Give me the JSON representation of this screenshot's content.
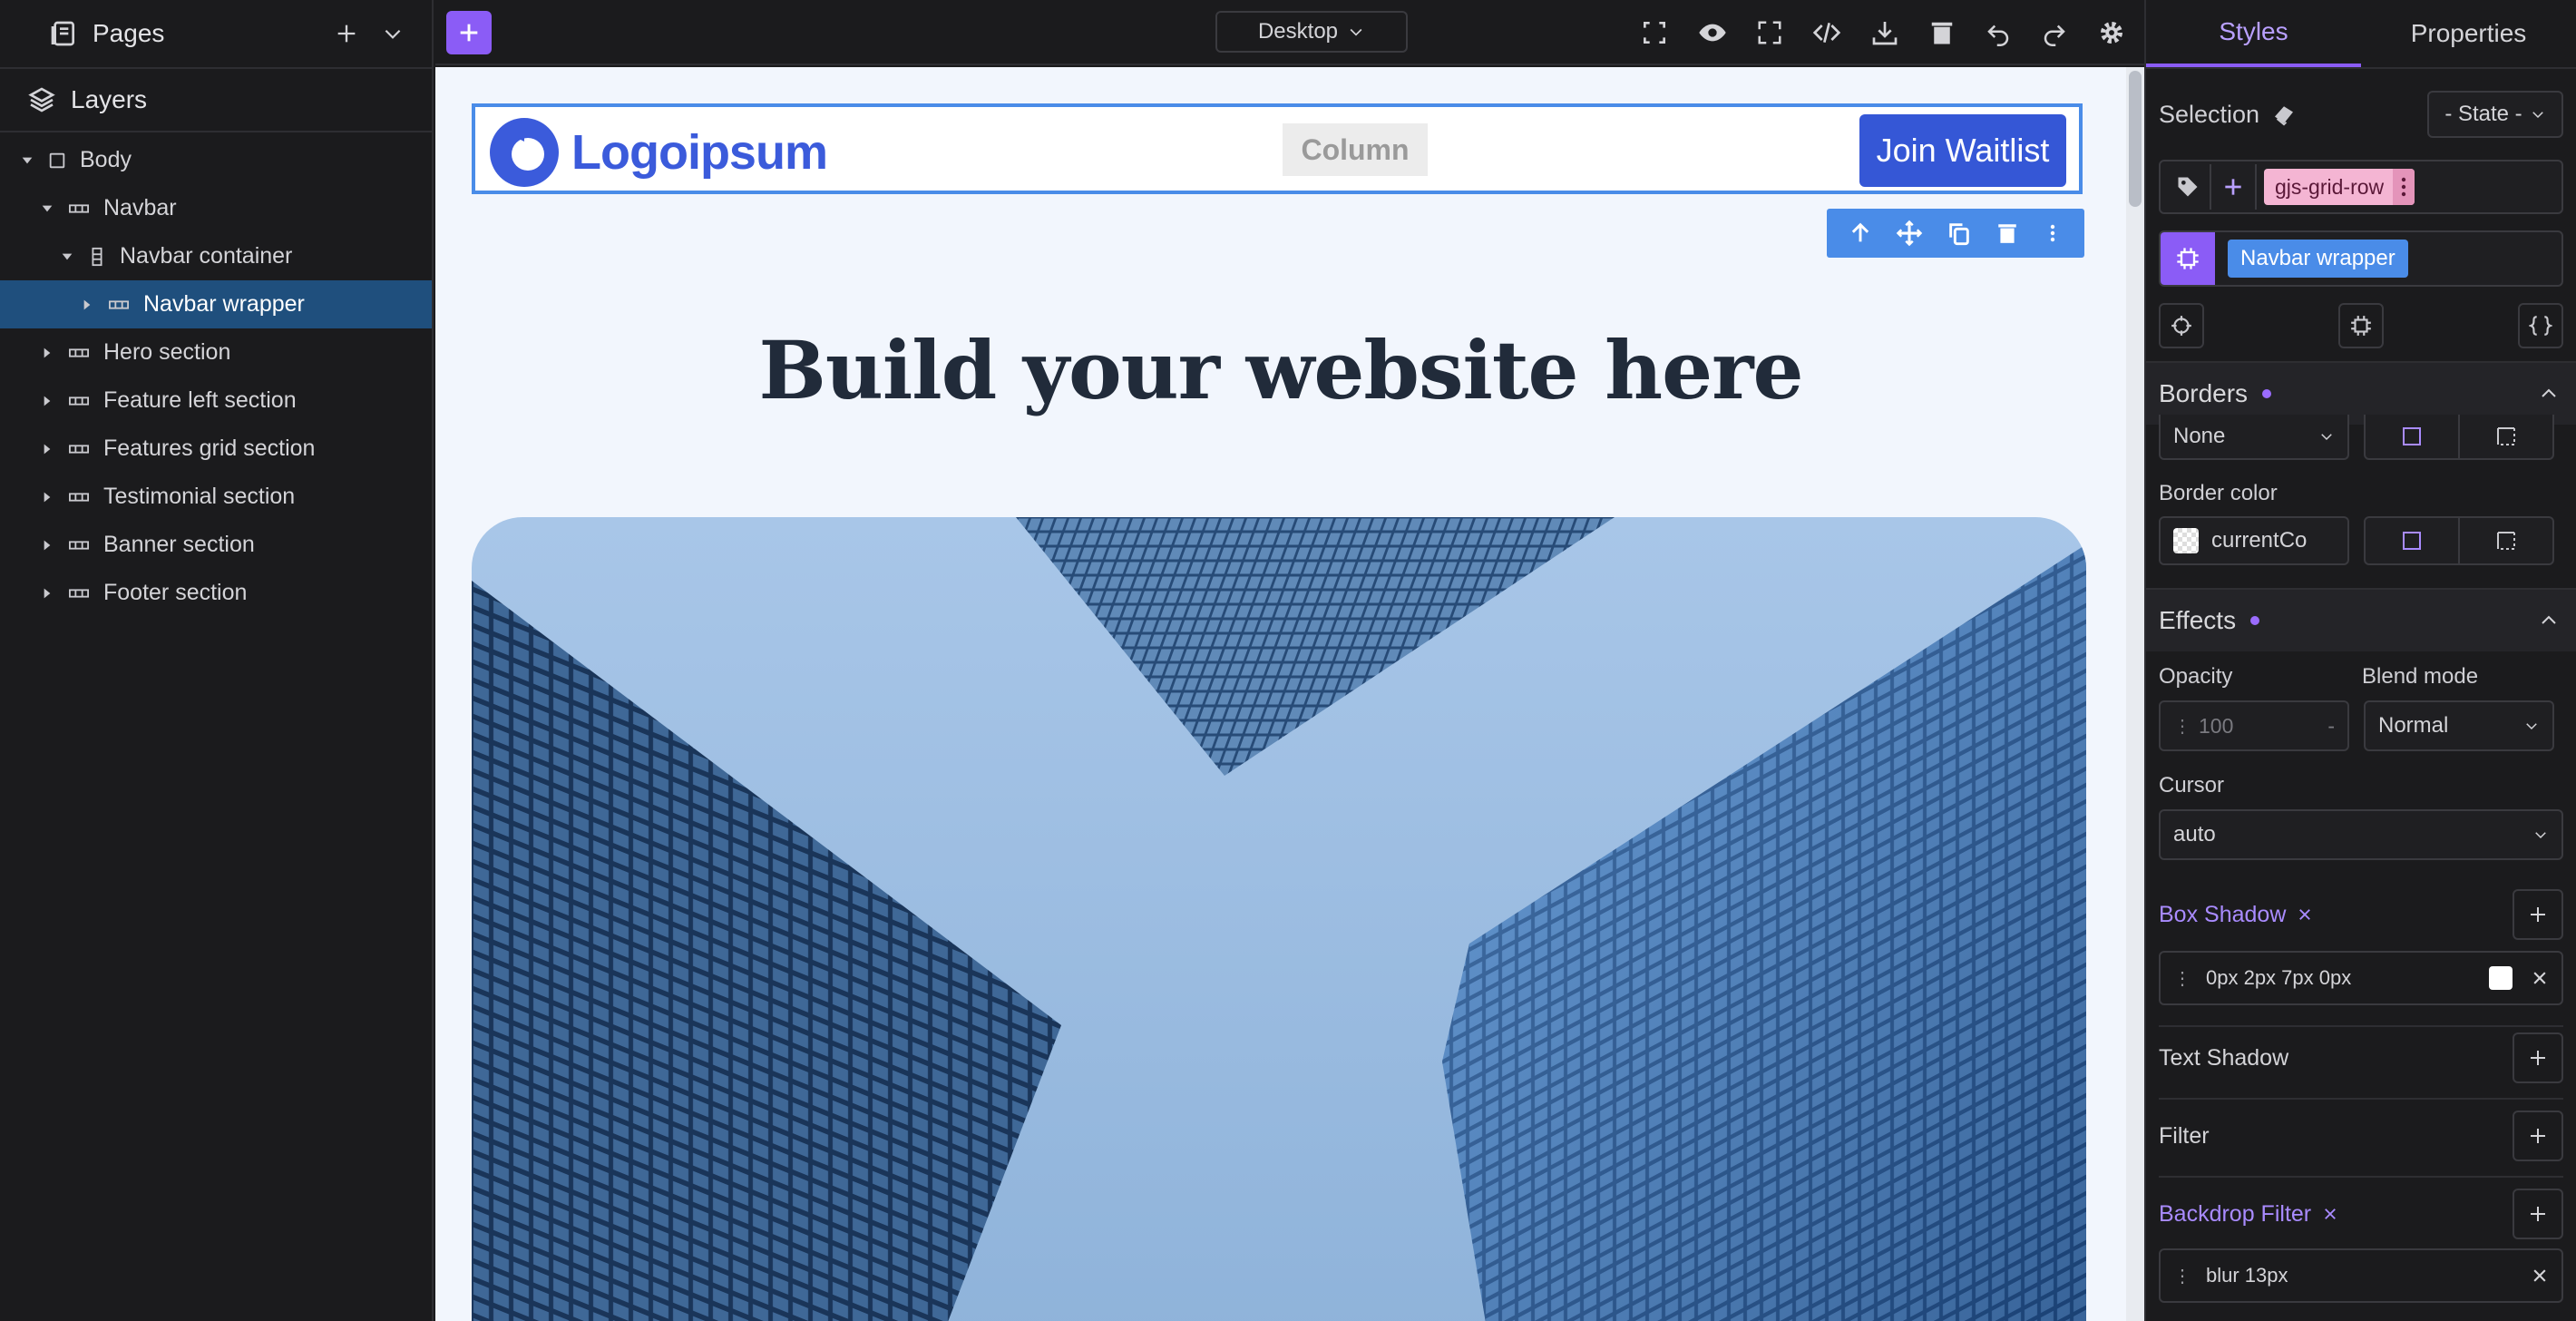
{
  "left_panel": {
    "pages_title": "Pages",
    "layers_title": "Layers",
    "tree": [
      {
        "label": "Body",
        "icon": "square-icon",
        "level": 0,
        "expanded": true
      },
      {
        "label": "Navbar",
        "icon": "row-icon",
        "level": 1,
        "expanded": true
      },
      {
        "label": "Navbar container",
        "icon": "column-icon",
        "level": 2,
        "expanded": true
      },
      {
        "label": "Navbar wrapper",
        "icon": "row-icon",
        "level": 3,
        "expanded": false,
        "selected": true
      },
      {
        "label": "Hero section",
        "icon": "row-icon",
        "level": 1,
        "expanded": false
      },
      {
        "label": "Feature left section",
        "icon": "row-icon",
        "level": 1,
        "expanded": false
      },
      {
        "label": "Features grid section",
        "icon": "row-icon",
        "level": 1,
        "expanded": false
      },
      {
        "label": "Testimonial section",
        "icon": "row-icon",
        "level": 1,
        "expanded": false
      },
      {
        "label": "Banner section",
        "icon": "row-icon",
        "level": 1,
        "expanded": false
      },
      {
        "label": "Footer section",
        "icon": "row-icon",
        "level": 1,
        "expanded": false
      }
    ]
  },
  "toolbar": {
    "device": "Desktop",
    "tools": [
      "select-area-icon",
      "eye-icon",
      "fullscreen-icon",
      "code-icon",
      "download-icon",
      "trash-icon",
      "undo-icon",
      "redo-icon",
      "settings-icon"
    ]
  },
  "canvas": {
    "logo_text": "Logoipsum",
    "column_label": "Column",
    "join_button": "Join Waitlist",
    "hero_title": "Build your website here"
  },
  "right_panel": {
    "tabs": [
      "Styles",
      "Properties"
    ],
    "active_tab": "Styles",
    "selection_label": "Selection",
    "state_select": "- State -",
    "class_tag": "gjs-grid-row",
    "component_tag": "Navbar wrapper",
    "borders": {
      "title": "Borders",
      "style_value": "None",
      "border_color_label": "Border color",
      "border_color_value": "currentCo"
    },
    "effects": {
      "title": "Effects",
      "opacity_label": "Opacity",
      "opacity_value": "100",
      "opacity_unit": "-",
      "blend_label": "Blend mode",
      "blend_value": "Normal",
      "cursor_label": "Cursor",
      "cursor_value": "auto",
      "box_shadow_label": "Box Shadow",
      "box_shadow_value": "0px 2px 7px 0px",
      "text_shadow_label": "Text Shadow",
      "filter_label": "Filter",
      "backdrop_label": "Backdrop Filter",
      "backdrop_value": "blur 13px"
    }
  },
  "colors": {
    "accent": "#8b5cf6",
    "selection_blue": "#4a8ce8",
    "brand_blue": "#3557d6",
    "selected_row": "#1f4f7d"
  }
}
